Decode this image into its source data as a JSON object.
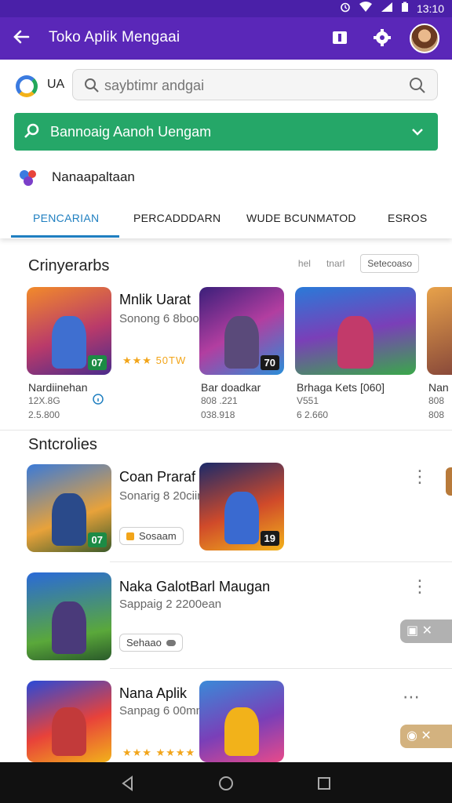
{
  "status": {
    "time": "13:10"
  },
  "appbar": {
    "title": "Toko Aplik Mengaai"
  },
  "search": {
    "prefix": "UA",
    "placeholder": "saybtimr andgai"
  },
  "filter": {
    "label": "Bannoaig Aanoh Uengam"
  },
  "subheader": {
    "label": "Nanaapaltaan"
  },
  "tabs": [
    "PENCARIAN",
    "PERCADDDARN",
    "WUDE BCUNMATOD",
    "ESROS"
  ],
  "section1": {
    "title": "Crinyerarbs",
    "chip1": "hel",
    "chip2": "tnarl",
    "chip3": "Setecoaso",
    "cards": [
      {
        "name": "Nardiinehan",
        "line2": "12X.8G",
        "line3": "2.5.800",
        "badge": "07"
      },
      {
        "name": "Mnlik Uarat",
        "line2": "Sonong 6 8boo",
        "rating": "★★★ 50TW",
        "badge": ""
      },
      {
        "name": "Bar doadkar",
        "line2": "808 .221",
        "line3": "038.918",
        "badge": "70"
      },
      {
        "name": "Brhaga Kets [060]",
        "line2": "V551",
        "line3": "6 2.660",
        "badge": ""
      },
      {
        "name": "Nan",
        "line2": "808",
        "line3": "808",
        "badge": ""
      }
    ]
  },
  "section2": {
    "title": "Sntcrolies",
    "items": [
      {
        "title": "Coan Praraf",
        "sub": "Sonarig 8 20ciin",
        "pill": "Sosaam",
        "badge": "07",
        "badge2": "19"
      },
      {
        "title": "Naka GalotBarl Maugan",
        "sub": "Sappaig 2 2200ean",
        "pill": "Sehaao",
        "badge": ""
      },
      {
        "title": "Nana Aplik",
        "sub": "Sanpag 6 00mn",
        "rating": "★★★ ★★★★",
        "badge": ""
      }
    ]
  },
  "colors": {
    "primary": "#5a27b8",
    "green": "#25a768",
    "tab": "#1f7fc0"
  }
}
